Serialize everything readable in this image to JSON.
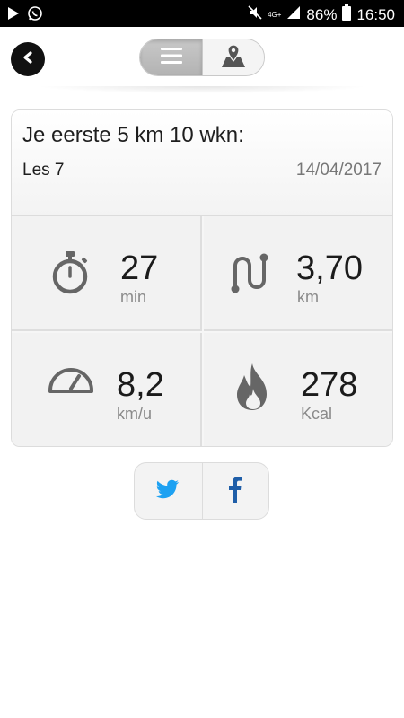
{
  "status_bar": {
    "battery": "86%",
    "time": "16:50",
    "network": "4G+",
    "icons": [
      "play-store-icon",
      "whatsapp-icon",
      "mute-icon",
      "signal-icon",
      "battery-icon"
    ]
  },
  "header": {
    "back_icon": "back-arrow-icon",
    "toggle": [
      {
        "icon": "list-icon",
        "active": true
      },
      {
        "icon": "map-pin-icon",
        "active": false
      }
    ]
  },
  "workout": {
    "title": "Je eerste 5 km 10 wkn:",
    "lesson": "Les 7",
    "date": "14/04/2017"
  },
  "stats": [
    {
      "icon": "stopwatch-icon",
      "value": "27",
      "unit": "min"
    },
    {
      "icon": "route-icon",
      "value": "3,70",
      "unit": "km"
    },
    {
      "icon": "speedometer-icon",
      "value": "8,2",
      "unit": "km/u"
    },
    {
      "icon": "flame-icon",
      "value": "278",
      "unit": "Kcal"
    }
  ],
  "share": [
    {
      "icon": "twitter-icon",
      "color": "#1da1f2"
    },
    {
      "icon": "facebook-icon",
      "color": "#1f5ea8"
    }
  ],
  "colors": {
    "icon_gray": "#666666",
    "accent_black": "#111111"
  }
}
